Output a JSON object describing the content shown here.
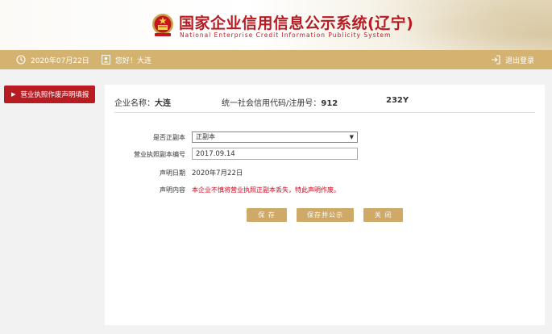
{
  "header": {
    "title_cn": "国家企业信用信息公示系统(辽宁)",
    "title_en": "National Enterprise Credit Information Publicity System",
    "emblem_icon": "national-emblem-icon"
  },
  "topbar": {
    "date": "2020年07月22日",
    "greeting": "您好！大连",
    "logout": "退出登录"
  },
  "sidebar": {
    "items": [
      {
        "label": "营业执照作废声明填报"
      }
    ]
  },
  "company": {
    "name_label": "企业名称：",
    "name": "大连",
    "code_label": "统一社会信用代码/注册号：",
    "code_prefix": "912",
    "code_suffix": "232Y"
  },
  "form": {
    "is_original_label": "是否正副本",
    "is_original_value": "正副本",
    "copy_number_label": "营业执照副本编号",
    "copy_number_value": "2017.09.14",
    "declare_date_label": "声明日期",
    "declare_date_value": "2020年7月22日",
    "declare_content_label": "声明内容",
    "declare_content_value": "本企业不慎将营业执照正副本丢失，特此声明作废。"
  },
  "buttons": {
    "save": "保 存",
    "save_publish": "保存并公示",
    "close": "关 闭"
  },
  "colors": {
    "brand_red": "#b81c22",
    "gold": "#d4b26f",
    "button_gold": "#cfa968",
    "notice_red": "#d0021b"
  }
}
